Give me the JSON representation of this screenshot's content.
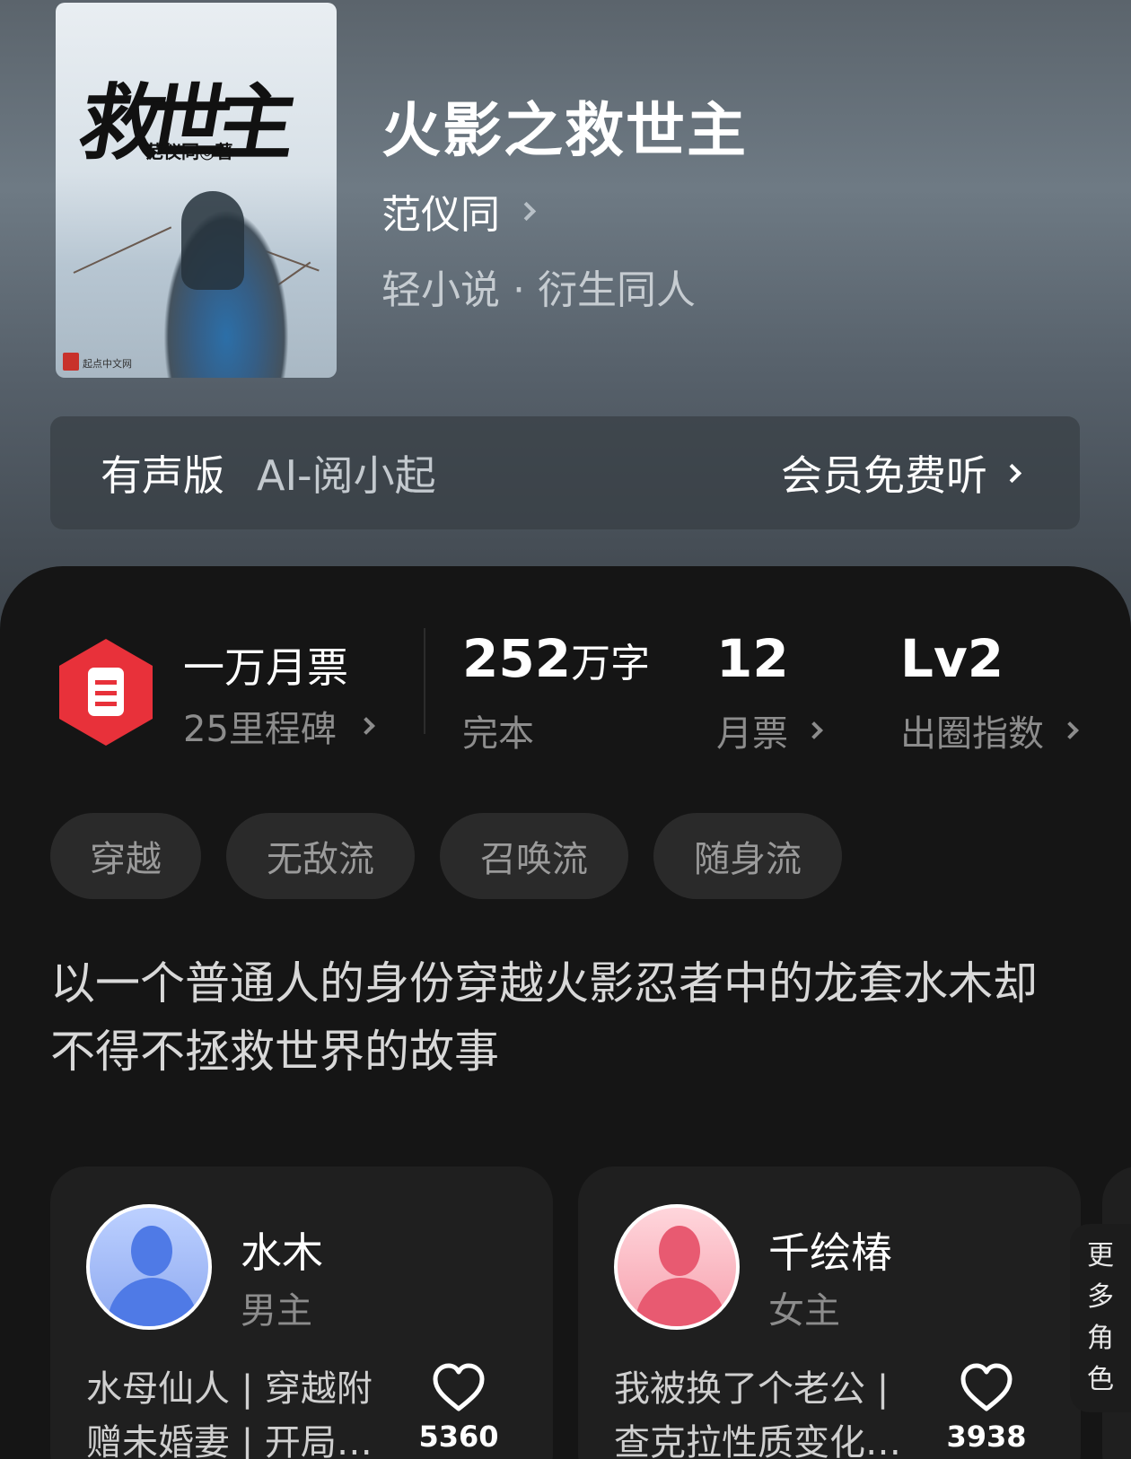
{
  "book": {
    "title": "火影之救世主",
    "author": "范仪同",
    "genre": "轻小说 · 衍生同人",
    "cover": {
      "calligraphy": "救世主",
      "author_credit": "范仪同◎著",
      "publisher_mark": "起点中文网"
    }
  },
  "audio": {
    "label": "有声版",
    "narrator": "AI-阅小起",
    "cta": "会员免费听"
  },
  "ticket": {
    "title": "一万月票",
    "subtitle": "25里程碑"
  },
  "stats": {
    "words_value": "252",
    "words_unit": "万字",
    "status": "完本",
    "monthly_votes_value": "12",
    "monthly_votes_label": "月票",
    "index_value": "Lv2",
    "index_label": "出圈指数"
  },
  "tags": [
    "穿越",
    "无敌流",
    "召唤流",
    "随身流"
  ],
  "synopsis": "以一个普通人的身份穿越火影忍者中的龙套水木却不得不拯救世界的故事",
  "characters": [
    {
      "name": "水木",
      "role": "男主",
      "desc": "水母仙人 | 穿越附赠未婚妻 | 开局…",
      "likes": "5360"
    },
    {
      "name": "千绘椿",
      "role": "女主",
      "desc": "我被换了个老公 | 查克拉性质变化…",
      "likes": "3938"
    }
  ],
  "more_roles": [
    "更",
    "多",
    "角",
    "色"
  ],
  "colors": {
    "ticket_red": "#e8313a",
    "panel_bg": "#151515",
    "card_bg": "#1f1f1f"
  }
}
